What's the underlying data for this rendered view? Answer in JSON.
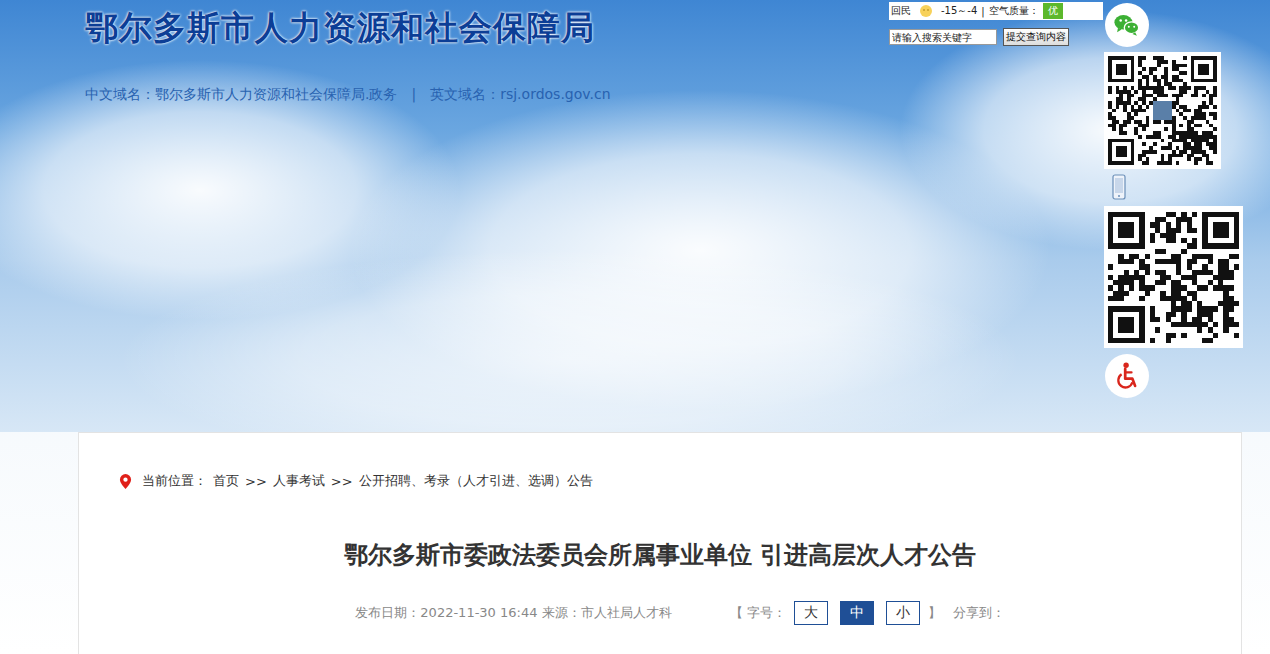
{
  "header": {
    "title": "鄂尔多斯市人力资源和社会保障局",
    "domain_cn": "中文域名：鄂尔多斯市人力资源和社会保障局.政务",
    "separator": "|",
    "domain_en": "英文域名：rsj.ordos.gov.cn"
  },
  "weather": {
    "city": "回民",
    "temp": "-15～-4",
    "separator": "|",
    "air_label": "空气质量：",
    "air_value": "优"
  },
  "search": {
    "placeholder": "请输入搜索关键字",
    "button": "提交查询内容"
  },
  "breadcrumb": {
    "label": "当前位置：",
    "separator": ">>",
    "items": [
      "首页",
      "人事考试",
      "公开招聘、考录（人才引进、选调）公告"
    ]
  },
  "article": {
    "title": "鄂尔多斯市委政法委员会所属事业单位 引进高层次人才公告",
    "date": "发布日期：2022-11-30 16:44",
    "source": "来源：市人社局人才科",
    "font_label": "【 字号：",
    "font_sizes": [
      {
        "label": "大",
        "selected": false
      },
      {
        "label": "中",
        "selected": true
      },
      {
        "label": "小",
        "selected": false
      }
    ],
    "font_close": "】",
    "share": "分享到："
  }
}
